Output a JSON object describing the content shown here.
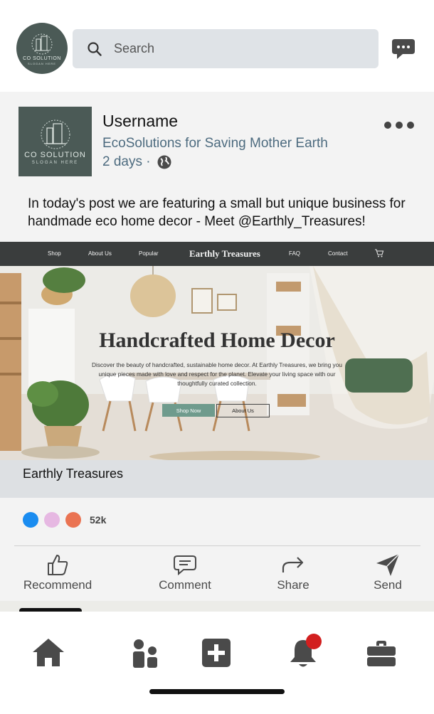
{
  "top_bar": {
    "logo_text": "CO SOLUTION",
    "logo_sub": "SLOGAN HERE",
    "search_placeholder": "Search",
    "icons": {
      "search": "search-icon",
      "chat": "chat-bubble-icon"
    }
  },
  "post": {
    "logo_text": "CO SOLUTION",
    "logo_sub": "SLOGAN HERE",
    "username": "Username",
    "organization": "EcoSolutions for Saving Mother Earth",
    "time": "2 days ·",
    "text": "In today's post we are featuring a small but unique business for handmade eco home decor - Meet @Earthly_Treasures!"
  },
  "site_preview": {
    "nav": [
      "Shop",
      "About Us",
      "Popular",
      "FAQ",
      "Contact"
    ],
    "brand": "Earthly Treasures",
    "hero_title": "Handcrafted Home Decor",
    "hero_desc": "Discover the beauty of handcrafted, sustainable home decor. At Earthly Treasures, we bring you unique pieces made with love and respect for the planet. Elevate your living space with our thoughtfully curated collection.",
    "shop_now": "Shop Now",
    "about_us": "About Us",
    "card_title": "Earthly Treasures"
  },
  "reactions": {
    "count": "52k",
    "colors": [
      "#1a8cf0",
      "#e6b8e2",
      "#ea7352"
    ]
  },
  "actions": [
    {
      "label": "Recommend",
      "icon": "thumbs-up-icon"
    },
    {
      "label": "Comment",
      "icon": "comment-icon"
    },
    {
      "label": "Share",
      "icon": "share-arrow-icon"
    },
    {
      "label": "Send",
      "icon": "send-icon"
    }
  ],
  "bottom_nav": {
    "icons": [
      "home-icon",
      "network-icon",
      "add-post-icon",
      "notifications-icon",
      "jobs-icon"
    ],
    "notification_color": "#d21f1f"
  }
}
